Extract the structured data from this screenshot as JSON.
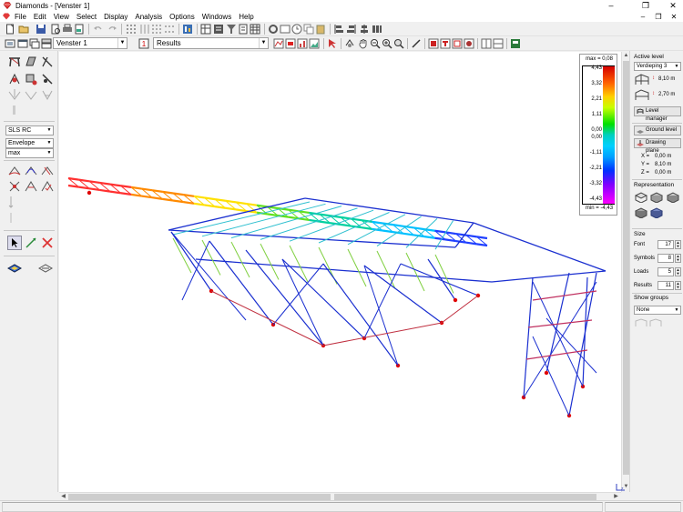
{
  "window": {
    "title": "Diamonds - [Venster 1]"
  },
  "menu": {
    "items": [
      "File",
      "Edit",
      "View",
      "Select",
      "Display",
      "Analysis",
      "Options",
      "Windows",
      "Help"
    ]
  },
  "toolbar2": {
    "window_combo": "Venster 1",
    "results_combo": "Results"
  },
  "leftpanel": {
    "combination": "SLS RC",
    "envelope": "Envelope",
    "extreme": "max"
  },
  "legend": {
    "max_label": "max = 0,08",
    "min_label": "min = -4,43",
    "ticks": [
      "4,43",
      "3,32",
      "2,21",
      "1,11",
      "0,00",
      "0,00",
      "-1,11",
      "-2,21",
      "-3,32",
      "-4,43"
    ]
  },
  "rightpanel": {
    "active_level_label": "Active level",
    "active_level_value": "Verdieping 3",
    "level_top": "8,10 m",
    "level_height": "2,70 m",
    "level_manager": "Level manager",
    "ground_level": "Ground level",
    "drawing_plane": "Drawing plane",
    "coords": [
      {
        "axis": "X =",
        "value": "0,00 m"
      },
      {
        "axis": "Y =",
        "value": "8,10 m"
      },
      {
        "axis": "Z =",
        "value": "0,00 m"
      }
    ],
    "representation_label": "Representation",
    "size_label": "Size",
    "sizes": [
      {
        "label": "Font",
        "value": "17"
      },
      {
        "label": "Symbols",
        "value": "8"
      },
      {
        "label": "Loads",
        "value": "5"
      },
      {
        "label": "Results",
        "value": "11"
      }
    ],
    "show_groups_label": "Show groups",
    "show_groups_value": "None"
  },
  "colors": {
    "member_blue": "#1a2fd0",
    "support_red": "#e00000",
    "canvas_bg": "#ffffff"
  },
  "icons": [
    "app-diamond-icon",
    "new-icon",
    "open-icon",
    "save-icon",
    "print-icon",
    "undo-icon",
    "redo-icon",
    "select-icon",
    "zoom-icon",
    "pan-icon",
    "node-icon",
    "beam-icon",
    "cross-icon",
    "axis-icon"
  ]
}
